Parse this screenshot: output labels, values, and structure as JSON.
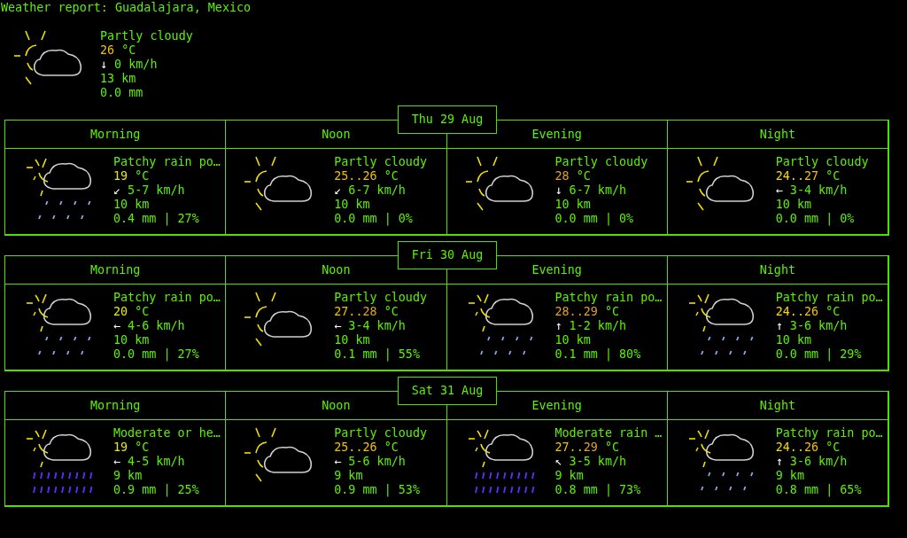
{
  "title": "Weather report: Guadalajara, Mexico",
  "current": {
    "kind": "partly_cloudy",
    "description": "Partly cloudy",
    "temperature": {
      "values": [
        {
          "text": "26",
          "color": "#f0c000"
        }
      ],
      "unit": "°C"
    },
    "wind": {
      "arrow": "↓",
      "speed": "0 km/h"
    },
    "visibility": "13 km",
    "precipitation": "0.0 mm"
  },
  "days": [
    {
      "date": "Thu 29 Aug",
      "periods": [
        {
          "name": "Morning",
          "kind": "light_rain",
          "description": "Patchy rain po…",
          "temperature": {
            "values": [
              {
                "text": "19",
                "color": "#e8e800"
              }
            ],
            "unit": "°C"
          },
          "wind": {
            "arrow": "↙",
            "speed": "5-7 km/h"
          },
          "visibility": "10 km",
          "precipitation": "0.4 mm | 27%"
        },
        {
          "name": "Noon",
          "kind": "partly_cloudy",
          "description": "Partly cloudy",
          "temperature": {
            "values": [
              {
                "text": "25..",
                "color": "#f0c000"
              },
              {
                "text": "26",
                "color": "#f0c000"
              }
            ],
            "unit": "°C"
          },
          "wind": {
            "arrow": "↙",
            "speed": "6-7 km/h"
          },
          "visibility": "10 km",
          "precipitation": "0.0 mm | 0%"
        },
        {
          "name": "Evening",
          "kind": "partly_cloudy",
          "description": "Partly cloudy",
          "temperature": {
            "values": [
              {
                "text": "28",
                "color": "#e0a030"
              }
            ],
            "unit": "°C"
          },
          "wind": {
            "arrow": "↓",
            "speed": "6-7 km/h"
          },
          "visibility": "10 km",
          "precipitation": "0.0 mm | 0%"
        },
        {
          "name": "Night",
          "kind": "partly_cloudy",
          "description": "Partly cloudy",
          "temperature": {
            "values": [
              {
                "text": "24..",
                "color": "#f5dc00"
              },
              {
                "text": "27",
                "color": "#f0c000"
              }
            ],
            "unit": "°C"
          },
          "wind": {
            "arrow": "←",
            "speed": "3-4 km/h"
          },
          "visibility": "10 km",
          "precipitation": "0.0 mm | 0%"
        }
      ]
    },
    {
      "date": "Fri 30 Aug",
      "periods": [
        {
          "name": "Morning",
          "kind": "light_rain",
          "description": "Patchy rain po…",
          "temperature": {
            "values": [
              {
                "text": "20",
                "color": "#e8e800"
              }
            ],
            "unit": "°C"
          },
          "wind": {
            "arrow": "←",
            "speed": "4-6 km/h"
          },
          "visibility": "10 km",
          "precipitation": "0.0 mm | 27%"
        },
        {
          "name": "Noon",
          "kind": "partly_cloudy",
          "description": "Partly cloudy",
          "temperature": {
            "values": [
              {
                "text": "27..",
                "color": "#f0c000"
              },
              {
                "text": "28",
                "color": "#e0a030"
              }
            ],
            "unit": "°C"
          },
          "wind": {
            "arrow": "←",
            "speed": "3-4 km/h"
          },
          "visibility": "10 km",
          "precipitation": "0.1 mm | 55%"
        },
        {
          "name": "Evening",
          "kind": "light_rain",
          "description": "Patchy rain po…",
          "temperature": {
            "values": [
              {
                "text": "28..",
                "color": "#e0a030"
              },
              {
                "text": "29",
                "color": "#e0a030"
              }
            ],
            "unit": "°C"
          },
          "wind": {
            "arrow": "↑",
            "speed": "1-2 km/h"
          },
          "visibility": "10 km",
          "precipitation": "0.1 mm | 80%"
        },
        {
          "name": "Night",
          "kind": "light_rain",
          "description": "Patchy rain po…",
          "temperature": {
            "values": [
              {
                "text": "24..",
                "color": "#f5dc00"
              },
              {
                "text": "26",
                "color": "#f0c000"
              }
            ],
            "unit": "°C"
          },
          "wind": {
            "arrow": "↑",
            "speed": "3-6 km/h"
          },
          "visibility": "10 km",
          "precipitation": "0.0 mm | 29%"
        }
      ]
    },
    {
      "date": "Sat 31 Aug",
      "periods": [
        {
          "name": "Morning",
          "kind": "heavy_rain",
          "description": "Moderate or he…",
          "temperature": {
            "values": [
              {
                "text": "19",
                "color": "#e8e800"
              }
            ],
            "unit": "°C"
          },
          "wind": {
            "arrow": "←",
            "speed": "4-5 km/h"
          },
          "visibility": "9 km",
          "precipitation": "0.9 mm | 25%"
        },
        {
          "name": "Noon",
          "kind": "partly_cloudy",
          "description": "Partly cloudy",
          "temperature": {
            "values": [
              {
                "text": "25..",
                "color": "#f0c000"
              },
              {
                "text": "26",
                "color": "#f0c000"
              }
            ],
            "unit": "°C"
          },
          "wind": {
            "arrow": "←",
            "speed": "5-6 km/h"
          },
          "visibility": "9 km",
          "precipitation": "0.9 mm | 53%"
        },
        {
          "name": "Evening",
          "kind": "heavy_rain",
          "description": "Moderate rain …",
          "temperature": {
            "values": [
              {
                "text": "27..",
                "color": "#f0c000"
              },
              {
                "text": "29",
                "color": "#e0a030"
              }
            ],
            "unit": "°C"
          },
          "wind": {
            "arrow": "↖",
            "speed": "3-5 km/h"
          },
          "visibility": "9 km",
          "precipitation": "0.8 mm | 73%"
        },
        {
          "name": "Night",
          "kind": "light_rain",
          "description": "Patchy rain po…",
          "temperature": {
            "values": [
              {
                "text": "24..",
                "color": "#f5dc00"
              },
              {
                "text": "26",
                "color": "#f0c000"
              }
            ],
            "unit": "°C"
          },
          "wind": {
            "arrow": "↑",
            "speed": "3-6 km/h"
          },
          "visibility": "9 km",
          "precipitation": "0.8 mm | 65%"
        }
      ]
    }
  ]
}
